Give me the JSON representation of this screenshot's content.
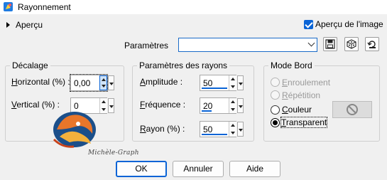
{
  "window": {
    "title": "Rayonnement"
  },
  "preview": {
    "section_label": "Aperçu",
    "image_preview_label": "Aperçu de l'image",
    "image_preview_checked": true
  },
  "params": {
    "label": "Paramètres",
    "value": ""
  },
  "groups": {
    "offset": {
      "title": "Décalage",
      "horizontal": {
        "label_u": "H",
        "label_rest": "orizontal (%) :",
        "value": "0,00"
      },
      "vertical": {
        "label_u": "V",
        "label_rest": "ertical (%) :",
        "value": "0"
      }
    },
    "rays": {
      "title": "Paramètres des rayons",
      "amplitude": {
        "label_u": "A",
        "label_rest": "mplitude :",
        "value": "50",
        "fill": 0.5
      },
      "frequency": {
        "label_u": "F",
        "label_rest": "réquence :",
        "value": "20",
        "fill": 0.2
      },
      "radius": {
        "label_u": "R",
        "label_rest": "ayon (%) :",
        "value": "50",
        "fill": 0.5
      }
    },
    "edge": {
      "title": "Mode Bord",
      "options": [
        {
          "label_u": "E",
          "label_rest": "nroulement",
          "enabled": false,
          "selected": false
        },
        {
          "label_u": "R",
          "label_rest": "épétition",
          "enabled": false,
          "selected": false
        },
        {
          "label_u": "C",
          "label_rest": "ouleur",
          "enabled": true,
          "selected": false
        },
        {
          "label_u": "T",
          "label_rest": "ransparent",
          "enabled": true,
          "selected": true
        }
      ]
    }
  },
  "buttons": {
    "ok": "OK",
    "cancel": "Annuler",
    "help": "Aide"
  },
  "watermark_text": "Michèle-Graph",
  "colors": {
    "accent": "#0a64d6",
    "title_bg": "#ffffff",
    "dialog_bg": "#f0f0f0"
  },
  "icons": [
    "app-icon",
    "save-preset-icon",
    "dice-icon",
    "reset-icon",
    "no-color-icon"
  ]
}
